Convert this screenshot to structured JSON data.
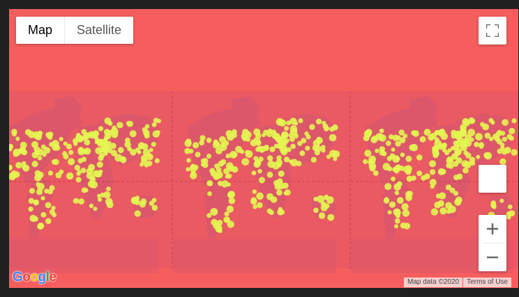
{
  "map_type_control": {
    "map_label": "Map",
    "satellite_label": "Satellite",
    "selected": "Map"
  },
  "controls": {
    "fullscreen_icon": "fullscreen-icon",
    "pegman_icon": "pegman-icon",
    "zoom_in_icon": "plus-icon",
    "zoom_out_icon": "minus-icon"
  },
  "logo": {
    "letters": [
      "G",
      "o",
      "o",
      "g",
      "l",
      "e"
    ]
  },
  "attribution": {
    "map_data": "Map data ©2020",
    "terms": "Terms of Use"
  },
  "colors": {
    "ocean_overlay": "#f65e5e",
    "land": "#dc5769",
    "points": "#e3f652",
    "gridline": "#c44050",
    "logo": [
      "#4285f4",
      "#ea4335",
      "#fbbc05",
      "#4285f4",
      "#34a853",
      "#ea4335"
    ]
  },
  "heatmap": {
    "point_count_shown": "many",
    "point_color_name": "yellow-green",
    "world_copies": 3
  }
}
